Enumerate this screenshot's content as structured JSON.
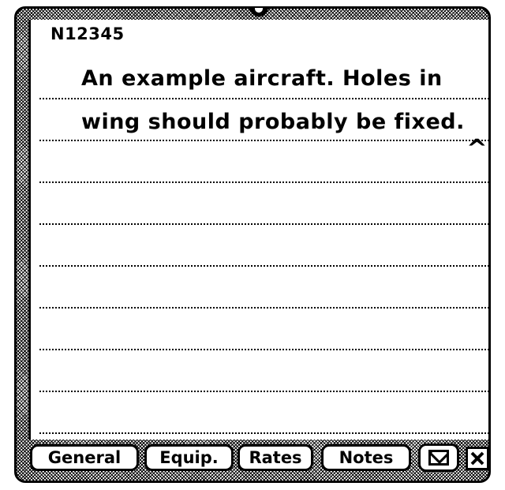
{
  "record": {
    "aircraft_id": "N12345"
  },
  "notes": {
    "lines": [
      "An example aircraft. Holes in",
      "wing should probably be fixed."
    ]
  },
  "tabs": {
    "general": "General",
    "equip": "Equip.",
    "rates": "Rates",
    "notes": "Notes"
  },
  "icons": {
    "mail": "mail-icon",
    "close": "close-icon",
    "caret": "caret-icon"
  },
  "colors": {
    "foreground": "#000000",
    "background": "#ffffff"
  }
}
